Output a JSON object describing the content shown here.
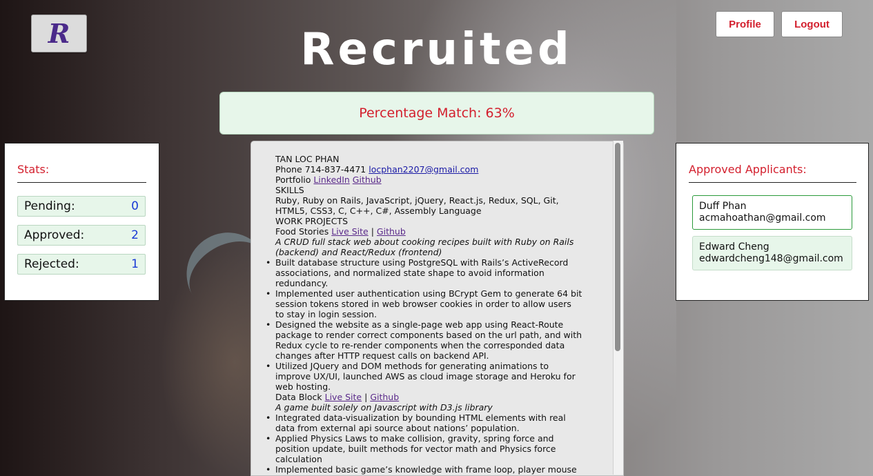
{
  "app": {
    "logo_letter": "R",
    "title": "Recruited",
    "profile_label": "Profile",
    "logout_label": "Logout"
  },
  "match": {
    "text": "Percentage Match: 63%"
  },
  "stats": {
    "title": "Stats:",
    "rows": [
      {
        "label": "Pending:",
        "value": "0"
      },
      {
        "label": "Approved:",
        "value": "2"
      },
      {
        "label": "Rejected:",
        "value": "1"
      }
    ]
  },
  "approved": {
    "title": "Approved Applicants:",
    "applicants": [
      {
        "name": "Duff Phan",
        "email": "acmahoathan@gmail.com"
      },
      {
        "name": "Edward Cheng",
        "email": "edwardcheng148@gmail.com"
      }
    ]
  },
  "resume": {
    "name": "TAN LOC PHAN",
    "phone_prefix": "Phone 714-837-4471",
    "email": "locphan2207@gmail.com",
    "portfolio_prefix": "Portfolio",
    "linkedin": "LinkedIn",
    "github": "Github",
    "skills_heading": "SKILLS",
    "skills_line1": "Ruby, Ruby on Rails, JavaScript, jQuery, React.js, Redux, SQL, Git,",
    "skills_line2": "HTML5, CSS3, C, C++, C#, Assembly Language",
    "work_heading": "WORK PROJECTS",
    "p1_name": "Food Stories",
    "p1_live": "Live Site",
    "sep": "|",
    "p1_github": "Github",
    "p1_desc1": "A CRUD full stack web about cooking recipes built with Ruby on Rails",
    "p1_desc2": "(backend) and React/Redux (frontend)",
    "p1_bullets": [
      [
        "Built database structure using PostgreSQL with Rails’s ActiveRecord",
        "associations, and normalized state shape to avoid information",
        "redundancy."
      ],
      [
        "Implemented user authentication using BCrypt Gem to generate 64 bit",
        "session tokens stored in web browser cookies in order to allow users",
        "to stay in login session."
      ],
      [
        "Designed the website as a single-page web app using React-Route",
        "package to render correct components based on the url path, and with",
        "Redux cycle to re-render components when the corresponded data",
        "changes after HTTP request calls on backend API."
      ],
      [
        "Utilized JQuery and DOM methods for generating animations to",
        "improve UX/UI, launched AWS as cloud image storage and Heroku for",
        "web hosting."
      ]
    ],
    "p2_name": "Data Block",
    "p2_live": "Live Site",
    "p2_github": "Github",
    "p2_desc": "A game built solely on Javascript with D3.js library",
    "p2_bullets": [
      [
        "Integrated data-visualization by bounding HTML elements with real",
        "data from external api source about nations’ population."
      ],
      [
        "Applied Physics Laws to make collision, gravity, spring force and",
        "position update, built methods for vector math and Physics force",
        "calculation"
      ],
      [
        "Implemented basic game’s knowledge with frame loop, player mouse"
      ]
    ]
  }
}
